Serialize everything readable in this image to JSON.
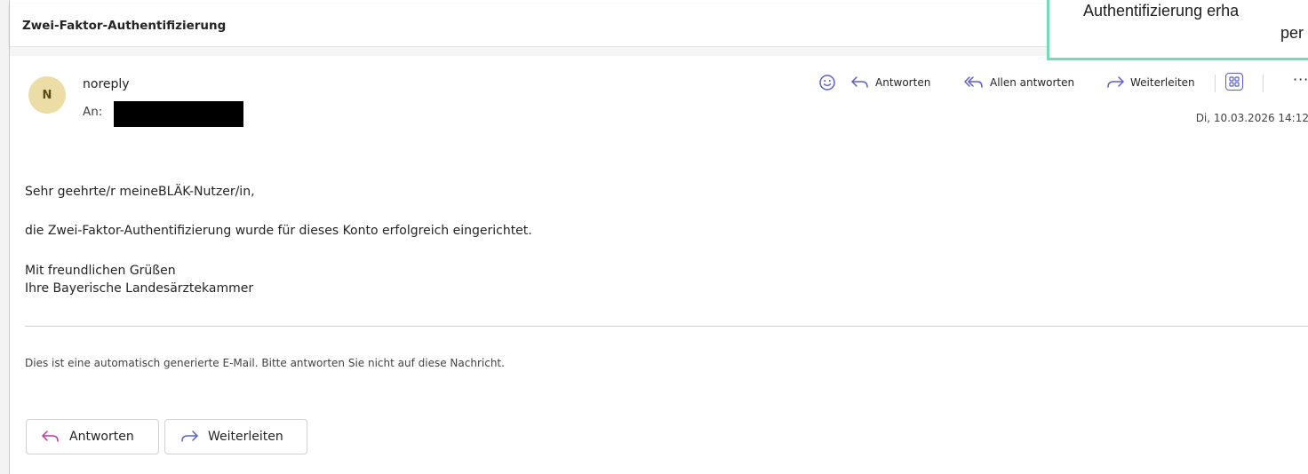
{
  "subject": "Zwei-Faktor-Authentifizierung",
  "callout": {
    "line1": "Authentifizierung erha",
    "line2": "per"
  },
  "sender": {
    "avatar_initial": "N",
    "name": "noreply",
    "to_label": "An:"
  },
  "toolbar": {
    "reply": "Antworten",
    "reply_all": "Allen antworten",
    "forward": "Weiterleiten",
    "more": "···",
    "date": "Di, 10.03.2026 14:12"
  },
  "body": {
    "greeting": "Sehr geehrte/r meineBLÄK-Nutzer/in,",
    "paragraph": "die Zwei-Faktor-Authentifizierung wurde für dieses Konto erfolgreich eingerichtet.",
    "closing1": "Mit freundlichen Grüßen",
    "closing2": "Ihre Bayerische Landesärztekammer",
    "footnote": "Dies ist eine automatisch generierte E-Mail. Bitte antworten Sie nicht auf diese Nachricht."
  },
  "bottom_buttons": {
    "reply": "Antworten",
    "forward": "Weiterleiten"
  },
  "colors": {
    "accent_purple": "#5b5fc7",
    "reply_icon": "#c0379b",
    "callout_border": "#73dcb4",
    "avatar_bg": "#ecdca6"
  }
}
